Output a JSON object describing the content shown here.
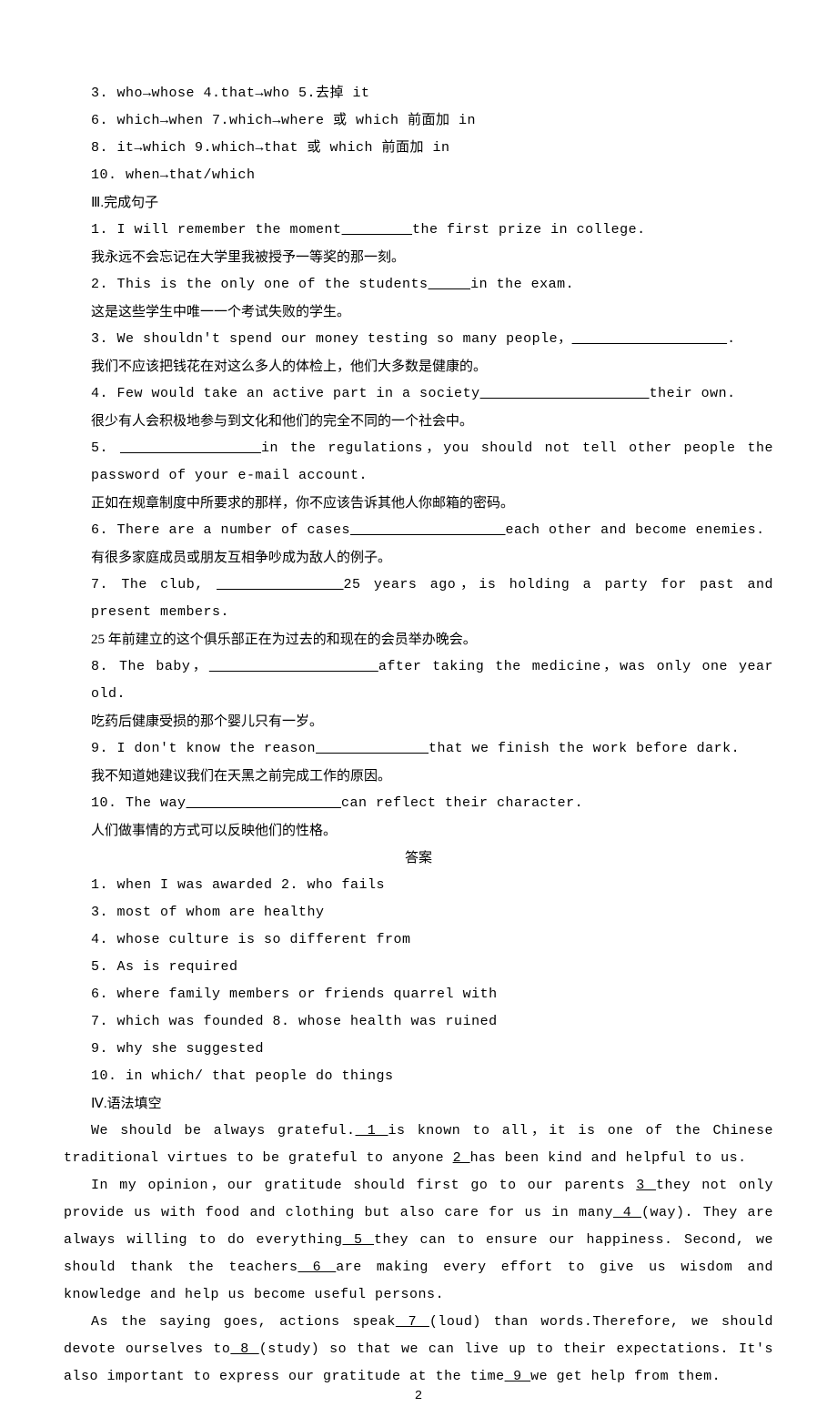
{
  "corrections": [
    "3. who→whose  4.that→who  5.去掉 it",
    "6. which→when  7.which→where 或 which 前面加 in",
    "8. it→which  9.which→that 或 which 前面加 in",
    "10. when→that/which"
  ],
  "section3": {
    "title": "Ⅲ.完成句子",
    "items": [
      {
        "en_pre": "1. I will remember the moment",
        "en_post": "the first prize in college.",
        "zh": "我永远不会忘记在大学里我被授予一等奖的那一刻。"
      },
      {
        "en_pre": "2. This is the only one of the students",
        "en_post": "in the exam.",
        "zh": "这是这些学生中唯一一个考试失败的学生。"
      },
      {
        "en_pre": "3. We shouldn't spend our money testing so many people，",
        "en_post": ".",
        "zh": "我们不应该把钱花在对这么多人的体检上，他们大多数是健康的。"
      },
      {
        "en_pre": "4. Few would take an active part in a society",
        "en_post": "their own.",
        "zh": "很少有人会积极地参与到文化和他们的完全不同的一个社会中。"
      },
      {
        "en_pre": "5. ",
        "en_post": "in the regulations，you should not tell other people the password of your e-mail account.",
        "zh": "正如在规章制度中所要求的那样，你不应该告诉其他人你邮箱的密码。"
      },
      {
        "en_pre": "6. There are a number of cases",
        "en_post": "each other and become enemies.",
        "zh": "有很多家庭成员或朋友互相争吵成为敌人的例子。"
      },
      {
        "en_pre": "7. The club,  ",
        "en_post": "25  years  ago，is  holding  a  party  for  past  and  present members.",
        "zh": "25 年前建立的这个俱乐部正在为过去的和现在的会员举办晚会。"
      },
      {
        "en_pre": "8. The baby，",
        "en_post": "after taking the medicine，was only one year old.",
        "zh": "吃药后健康受损的那个婴儿只有一岁。"
      },
      {
        "en_pre": "9. I don't know the reason",
        "en_post": "that we finish the work before dark.",
        "zh": "我不知道她建议我们在天黑之前完成工作的原因。"
      },
      {
        "en_pre": "10. The way",
        "en_post": "can reflect their character.",
        "zh": "人们做事情的方式可以反映他们的性格。"
      }
    ],
    "answer_title": "答案",
    "answers": [
      "1. when I was awarded  2. who fails",
      "3. most of whom are healthy",
      "4. whose culture is so different from",
      "5. As is required",
      "6. where family members or friends quarrel with",
      "7. which was founded  8. whose health was ruined",
      "9. why she suggested",
      "10. in which/ that people do things"
    ]
  },
  "section4": {
    "title": "Ⅳ.语法填空",
    "p1a": "We should be always grateful.",
    "b1": "  1  ",
    "p1b": "is known to all，it is one of the Chinese traditional virtues to be grateful to anyone ",
    "b2": "  2  ",
    "p1c": " has been kind and helpful to us.",
    "p2a": " In my opinion，our gratitude should first go to our parents ",
    "b3": "  3  ",
    "p2b": "they not only provide us with food and clothing but also care for us in many",
    "b4": "  4  ",
    "p2c": "(way). They are always willing to do everything",
    "b5": "  5  ",
    "p2d": "they can to ensure our happiness. Second, we should thank the teachers",
    "b6": "  6  ",
    "p2e": "are making every effort to give us wisdom and knowledge and help us become useful persons.",
    "p3a": "  As  the  saying  goes,  actions  speak",
    "b7": "  7  ",
    "p3b": "(loud)  than  words.Therefore,  we  should  devote ourselves to",
    "b8": "  8  ",
    "p3c": "(study) so that we can live up to their expectations. It's also important to express our gratitude at the time",
    "b9": "  9  ",
    "p3d": "we get help from them."
  },
  "page_number": "2"
}
